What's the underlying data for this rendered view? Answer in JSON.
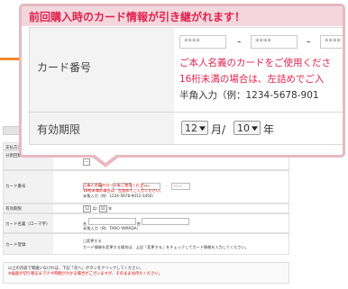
{
  "popup": {
    "title": "前回購入時のカード情報が引き継がれます！",
    "card_label": "カード番号",
    "card_placeholder": "****",
    "dash": "-",
    "note_red_1": "ご本人名義のカードをご使用くださ",
    "note_red_2": "16桁未満の場合は、左詰めでご入",
    "note_format": "半角入力（例：1234-5678-901",
    "expiry_label": "有効期限",
    "expiry_month": "12",
    "expiry_month_unit": "月/",
    "expiry_year": "10",
    "expiry_year_unit": "年"
  },
  "form": {
    "payment_label": "支払方法",
    "payment_value": "一括払い",
    "installments_label": "分割回数",
    "installments_value": "---",
    "card_label": "カード番号",
    "card_fields": [
      "****",
      "****",
      "****",
      "3147"
    ],
    "card_dash": "-",
    "card_note_1": "ご本人名義のカードをご使用ください。",
    "card_note_2": "16桁未満の場合は、左詰めでご入力ください。",
    "card_note_3": "半角入力（例：1234-5678-9012-3456）",
    "expiry_label": "有効期限",
    "expiry_month": "12",
    "expiry_month_unit": "月/",
    "expiry_year": "10",
    "expiry_year_unit": "年",
    "name_label": "カード名義（ローマ字）",
    "name_first_label": "名",
    "name_last_label": "姓",
    "name_note": "半角入力（例：TARO YAMADA）",
    "register_label": "カード登録",
    "register_checkbox": "□変更する",
    "register_note": "カード情報を変更する場合は、上記「変更する」をチェックしてカード情報を入力してください。"
  },
  "footer": {
    "line1": "以上の内容で間違いなければ、下記「次へ」ボタンをクリックしてください。",
    "line2": "※画面が切り替るまで少々時間がかかる場合がございますが、そのままお待ちください。"
  }
}
